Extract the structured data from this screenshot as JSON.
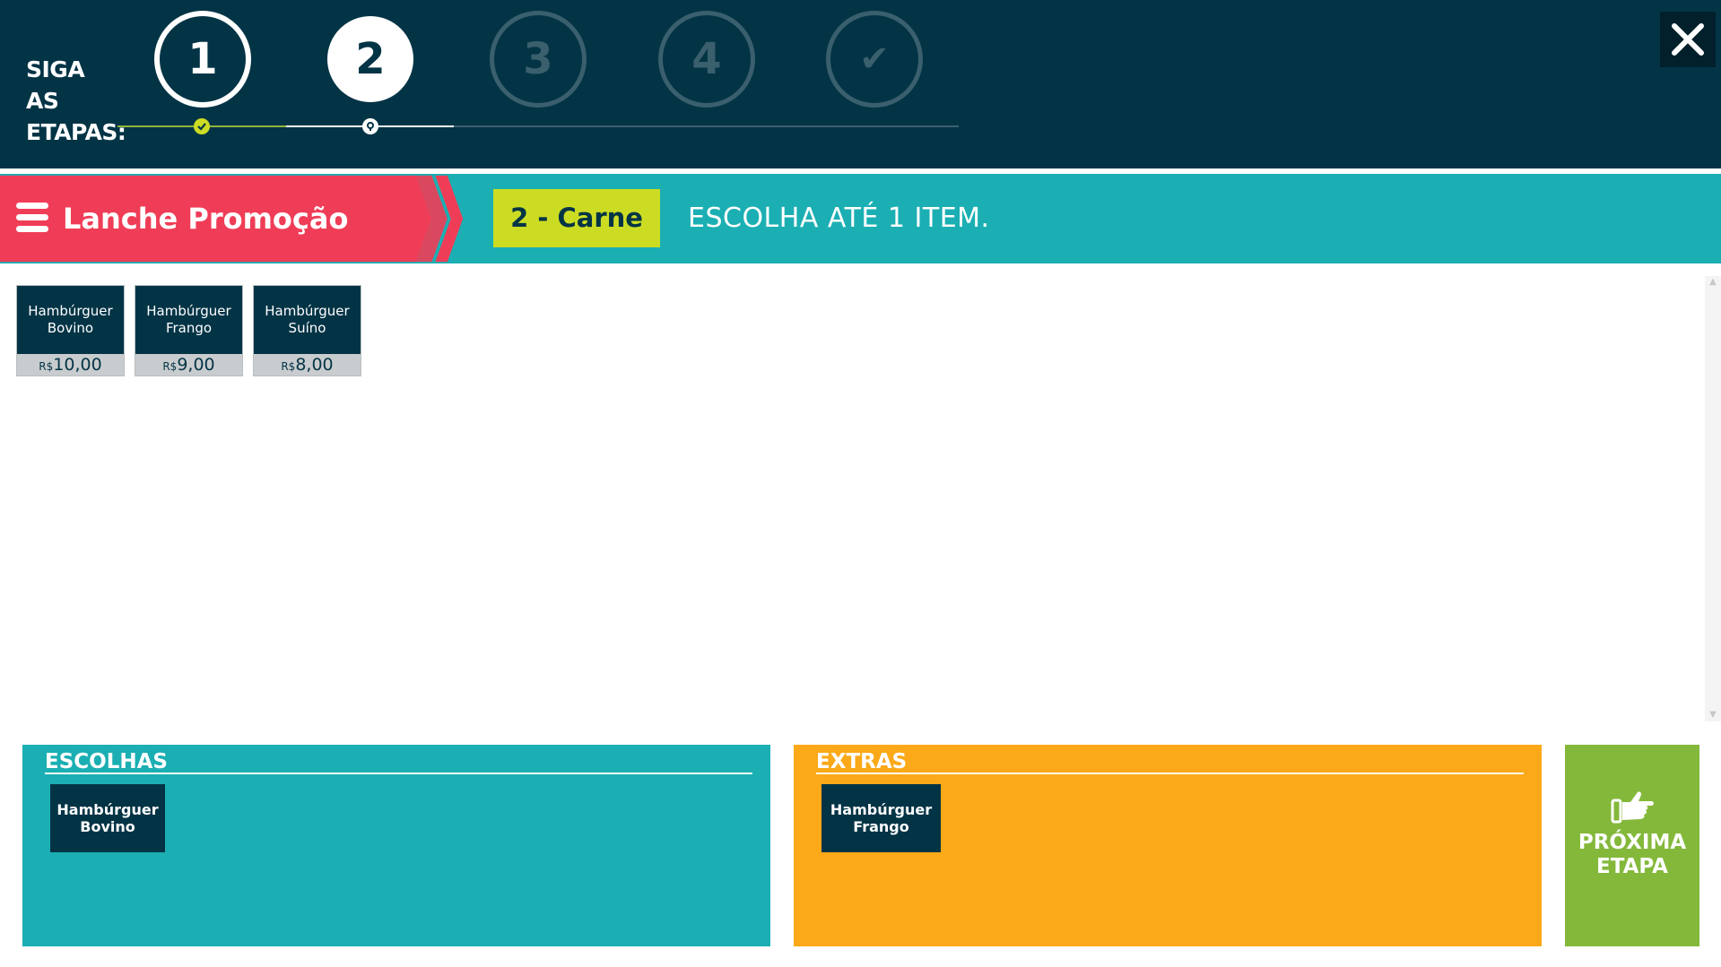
{
  "stepper": {
    "label": "SIGA AS ETAPAS:",
    "steps": [
      {
        "label": "1",
        "state": "done"
      },
      {
        "label": "2",
        "state": "current"
      },
      {
        "label": "3",
        "state": "todo"
      },
      {
        "label": "4",
        "state": "todo"
      },
      {
        "label": "✔",
        "state": "todo"
      }
    ]
  },
  "category": {
    "title": "Lanche Promoção",
    "step_label": "2 - Carne",
    "hint": "ESCOLHA ATÉ 1 ITEM."
  },
  "products": [
    {
      "name": "Hambúrguer Bovino",
      "currency": "R$",
      "price": "10,00"
    },
    {
      "name": "Hambúrguer Frango",
      "currency": "R$",
      "price": "9,00"
    },
    {
      "name": "Hambúrguer Suíno",
      "currency": "R$",
      "price": "8,00"
    }
  ],
  "choices": {
    "title": "ESCOLHAS",
    "items": [
      "Hambúrguer Bovino"
    ]
  },
  "extras": {
    "title": "EXTRAS",
    "items": [
      "Hambúrguer Frango"
    ]
  },
  "next_button": {
    "label": "PRÓXIMA ETAPA",
    "icon": "pointing-hand-icon"
  },
  "colors": {
    "header": "#033446",
    "category_red": "#f03d57",
    "teal": "#1bafb3",
    "lime": "#ccdc23",
    "orange": "#fba918",
    "green": "#84b83b"
  }
}
